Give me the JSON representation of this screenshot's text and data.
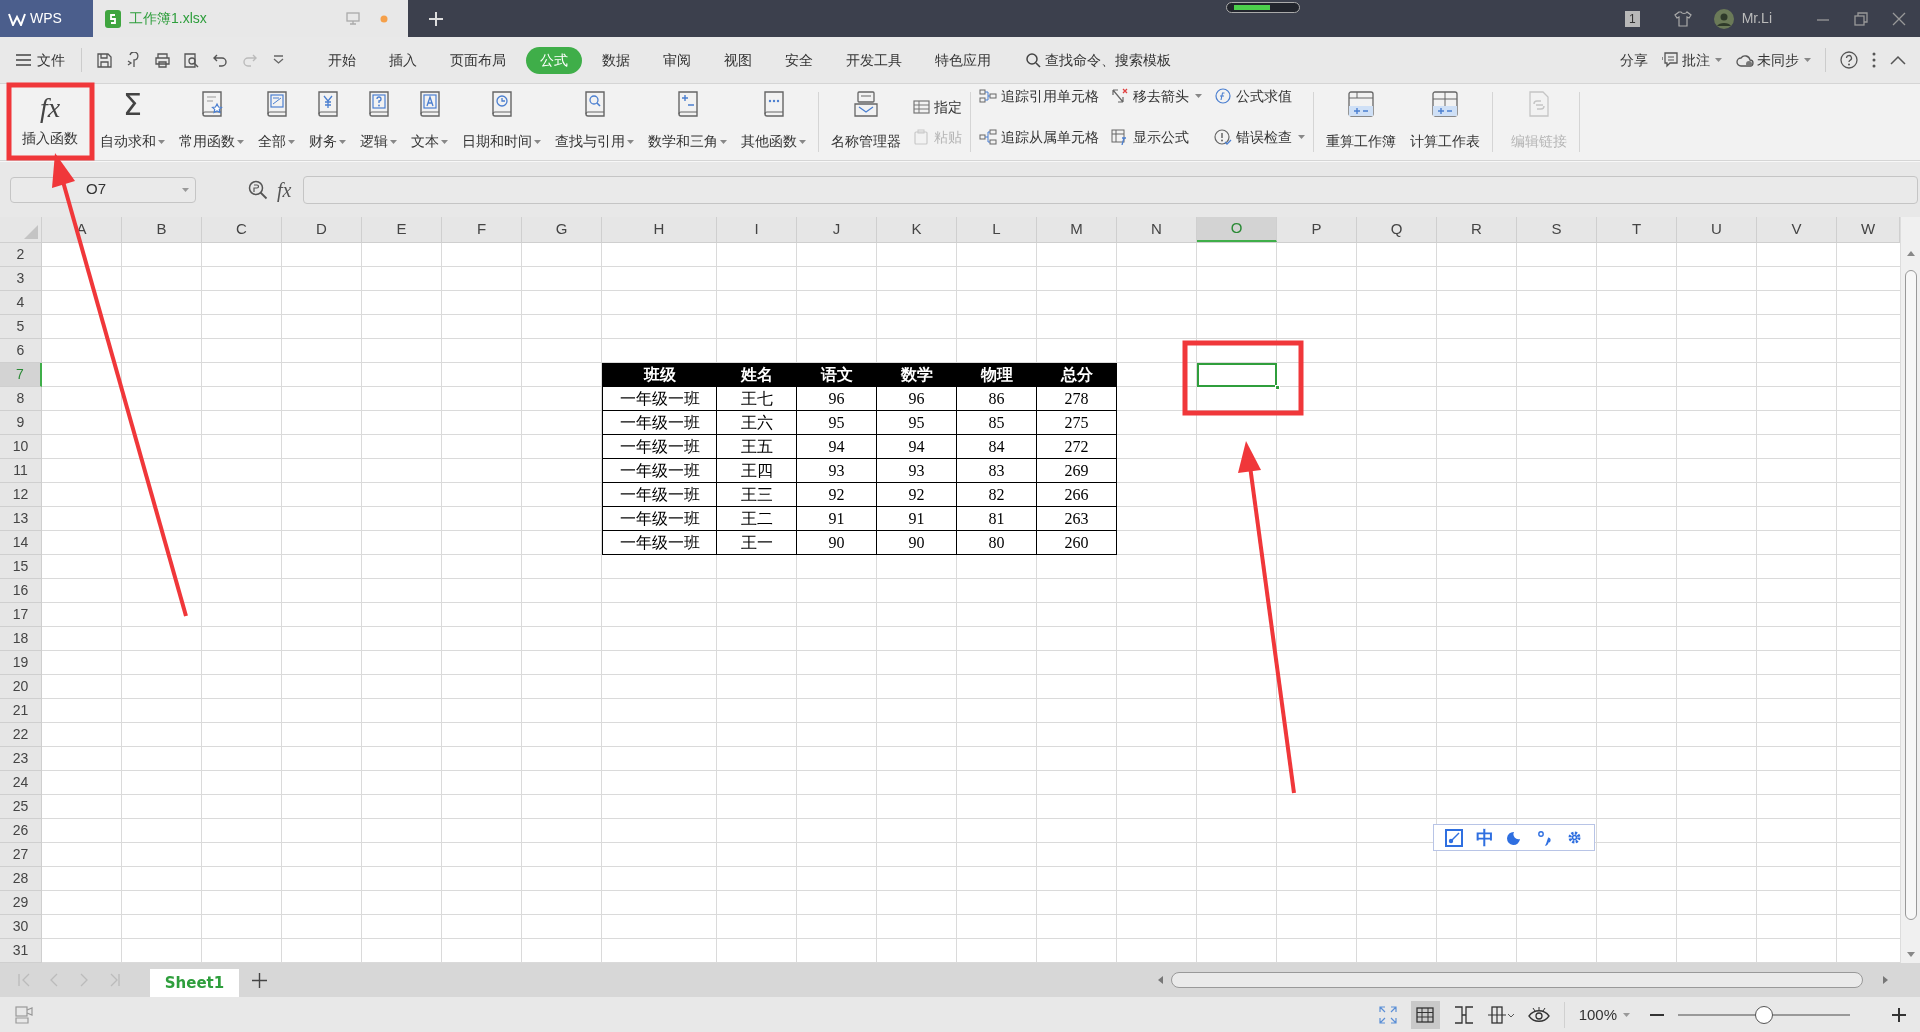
{
  "title_bar": {
    "app_tab": "WPS",
    "doc_tab": "工作簿1.xlsx",
    "window_count": "1",
    "user": "Mr.Li"
  },
  "menu": {
    "file": "文件",
    "tabs": [
      {
        "label": "开始",
        "selected": false
      },
      {
        "label": "插入",
        "selected": false
      },
      {
        "label": "页面布局",
        "selected": false
      },
      {
        "label": "公式",
        "selected": true
      },
      {
        "label": "数据",
        "selected": false
      },
      {
        "label": "审阅",
        "selected": false
      },
      {
        "label": "视图",
        "selected": false
      },
      {
        "label": "安全",
        "selected": false
      },
      {
        "label": "开发工具",
        "selected": false
      },
      {
        "label": "特色应用",
        "selected": false
      }
    ],
    "search": "查找命令、搜索模板",
    "share": "分享",
    "comment": "批注",
    "sync": "未同步"
  },
  "ribbon": {
    "function_buttons": [
      {
        "label": "插入函数",
        "symbol": "fx",
        "dropdown": false
      },
      {
        "label": "自动求和",
        "symbol": "Σ",
        "dropdown": true
      },
      {
        "label": "常用函数",
        "dropdown": true
      },
      {
        "label": "全部",
        "dropdown": true
      },
      {
        "label": "财务",
        "dropdown": true
      },
      {
        "label": "逻辑",
        "dropdown": true
      },
      {
        "label": "文本",
        "dropdown": true
      },
      {
        "label": "日期和时间",
        "dropdown": true
      },
      {
        "label": "查找与引用",
        "dropdown": true
      },
      {
        "label": "数学和三角",
        "dropdown": true
      },
      {
        "label": "其他函数",
        "dropdown": true
      }
    ],
    "name_manager": "名称管理器",
    "name_actions": [
      {
        "label": "指定",
        "disabled": false
      },
      {
        "label": "粘贴",
        "disabled": true
      }
    ],
    "audit_actions": [
      {
        "label": "追踪引用单元格",
        "dropdown": false
      },
      {
        "label": "追踪从属单元格",
        "dropdown": false
      },
      {
        "label": "移去箭头",
        "dropdown": true
      },
      {
        "label": "显示公式",
        "dropdown": false
      },
      {
        "label": "公式求值",
        "dropdown": false
      },
      {
        "label": "错误检查",
        "dropdown": true
      }
    ],
    "calc_buttons": [
      {
        "label": "重算工作簿",
        "disabled": false
      },
      {
        "label": "计算工作表",
        "disabled": false
      },
      {
        "label": "编辑链接",
        "disabled": true
      }
    ]
  },
  "formula_bar": {
    "name_box": "O7",
    "fx": "fx"
  },
  "sheet": {
    "columns": [
      {
        "label": "A",
        "selected": false
      },
      {
        "label": "B",
        "selected": false
      },
      {
        "label": "C",
        "selected": false
      },
      {
        "label": "D",
        "selected": false
      },
      {
        "label": "E",
        "selected": false
      },
      {
        "label": "F",
        "selected": false
      },
      {
        "label": "G",
        "selected": false
      },
      {
        "label": "H",
        "selected": false
      },
      {
        "label": "I",
        "selected": false
      },
      {
        "label": "J",
        "selected": false
      },
      {
        "label": "K",
        "selected": false
      },
      {
        "label": "L",
        "selected": false
      },
      {
        "label": "M",
        "selected": false
      },
      {
        "label": "N",
        "selected": false
      },
      {
        "label": "O",
        "selected": true
      },
      {
        "label": "P",
        "selected": false
      },
      {
        "label": "Q",
        "selected": false
      },
      {
        "label": "R",
        "selected": false
      },
      {
        "label": "S",
        "selected": false
      },
      {
        "label": "T",
        "selected": false
      },
      {
        "label": "U",
        "selected": false
      },
      {
        "label": "V",
        "selected": false
      },
      {
        "label": "W",
        "selected": false
      }
    ],
    "rows": [
      {
        "label": "2",
        "selected": false
      },
      {
        "label": "3",
        "selected": false
      },
      {
        "label": "4",
        "selected": false
      },
      {
        "label": "5",
        "selected": false
      },
      {
        "label": "6",
        "selected": false
      },
      {
        "label": "7",
        "selected": true
      },
      {
        "label": "8",
        "selected": false
      },
      {
        "label": "9",
        "selected": false
      },
      {
        "label": "10",
        "selected": false
      },
      {
        "label": "11",
        "selected": false
      },
      {
        "label": "12",
        "selected": false
      },
      {
        "label": "13",
        "selected": false
      },
      {
        "label": "14",
        "selected": false
      },
      {
        "label": "15",
        "selected": false
      },
      {
        "label": "16",
        "selected": false
      },
      {
        "label": "17",
        "selected": false
      },
      {
        "label": "18",
        "selected": false
      },
      {
        "label": "19",
        "selected": false
      },
      {
        "label": "20",
        "selected": false
      },
      {
        "label": "21",
        "selected": false
      },
      {
        "label": "22",
        "selected": false
      },
      {
        "label": "23",
        "selected": false
      },
      {
        "label": "24",
        "selected": false
      },
      {
        "label": "25",
        "selected": false
      },
      {
        "label": "26",
        "selected": false
      },
      {
        "label": "27",
        "selected": false
      },
      {
        "label": "28",
        "selected": false
      },
      {
        "label": "29",
        "selected": false
      },
      {
        "label": "30",
        "selected": false
      },
      {
        "label": "31",
        "selected": false
      }
    ],
    "table": {
      "columns": [
        "班级",
        "姓名",
        "语文",
        "数学",
        "物理",
        "总分"
      ],
      "rows": [
        [
          "一年级一班",
          "王七",
          "96",
          "96",
          "86",
          "278"
        ],
        [
          "一年级一班",
          "王六",
          "95",
          "95",
          "85",
          "275"
        ],
        [
          "一年级一班",
          "王五",
          "94",
          "94",
          "84",
          "272"
        ],
        [
          "一年级一班",
          "王四",
          "93",
          "93",
          "83",
          "269"
        ],
        [
          "一年级一班",
          "王三",
          "92",
          "92",
          "82",
          "266"
        ],
        [
          "一年级一班",
          "王二",
          "91",
          "91",
          "81",
          "263"
        ],
        [
          "一年级一班",
          "王一",
          "90",
          "90",
          "80",
          "260"
        ]
      ]
    }
  },
  "ime_toolbar": {
    "mode": "中"
  },
  "sheet_tabs": [
    {
      "label": "Sheet1",
      "selected": true
    }
  ],
  "status_bar": {
    "zoom": "100%",
    "zoom_slider": {
      "level": 0.5
    }
  }
}
